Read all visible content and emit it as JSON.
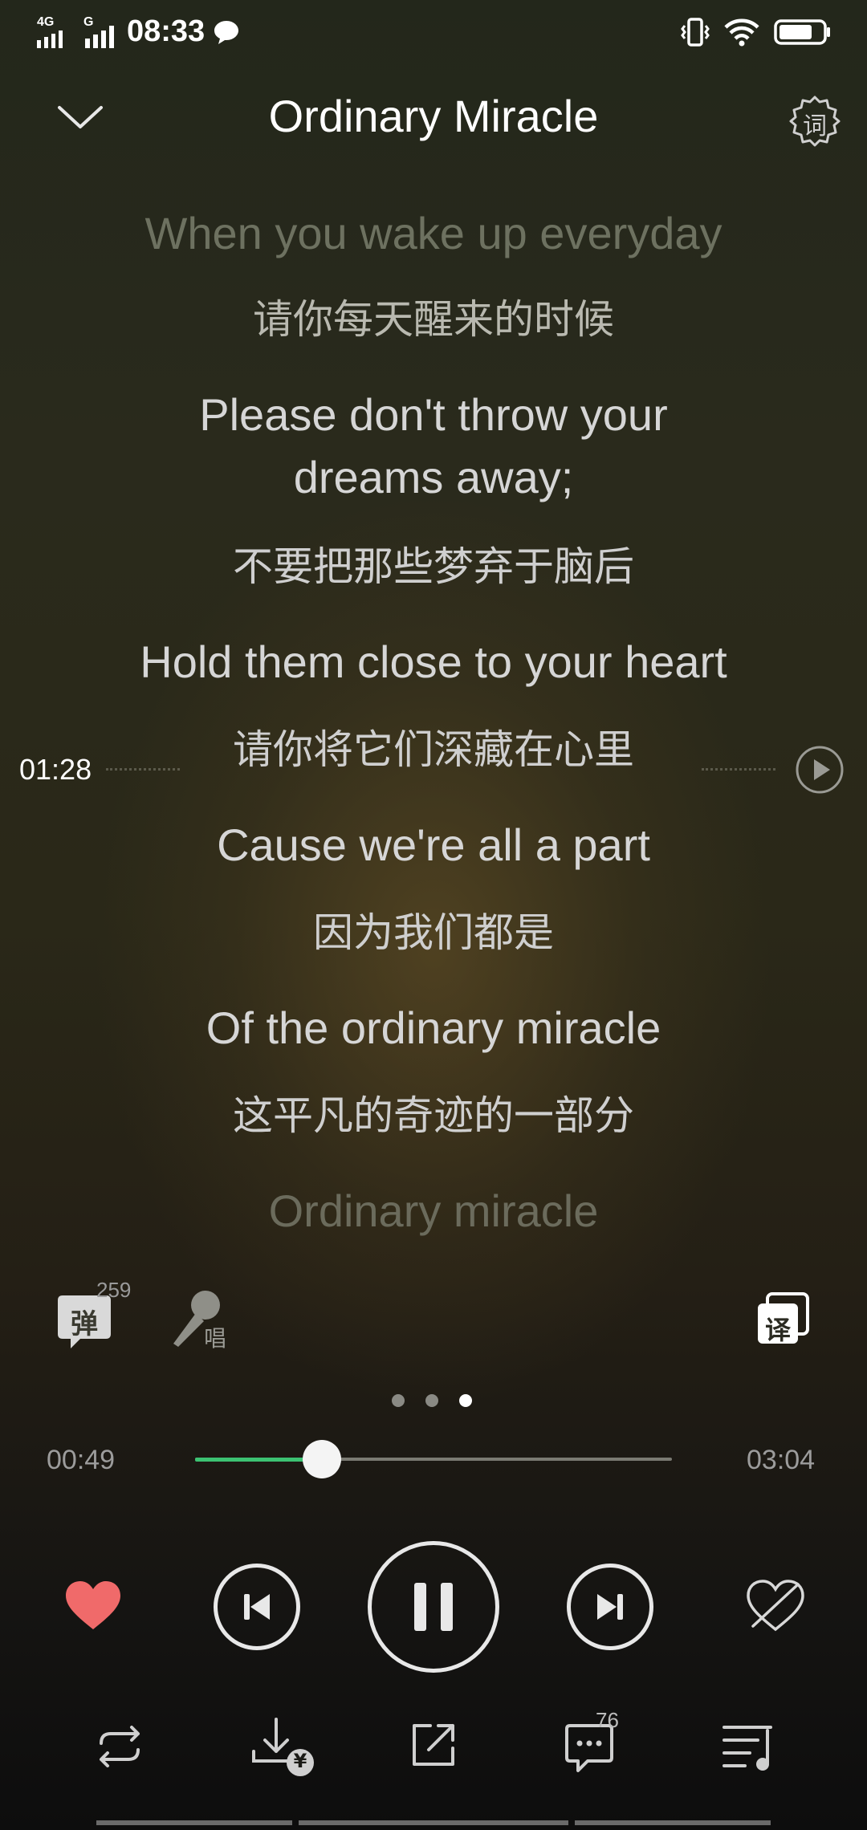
{
  "status_bar": {
    "network_1": "4G",
    "network_2": "G",
    "time": "08:33",
    "icons": [
      "signal-icon",
      "signal-icon",
      "message-bubble-icon",
      "vibrate-icon",
      "wifi-icon",
      "battery-icon"
    ]
  },
  "header": {
    "title": "Ordinary Miracle",
    "lyrics_settings_label": "词"
  },
  "lyrics": [
    {
      "en": "When you wake up everyday",
      "zh": "请你每天醒来的时候"
    },
    {
      "en": "Please don't throw your dreams away;",
      "zh": "不要把那些梦弃于脑后"
    },
    {
      "en": "Hold them close to your heart",
      "zh": "请你将它们深藏在心里"
    },
    {
      "en": "Cause we're all a part",
      "zh": "因为我们都是"
    },
    {
      "en": "Of the ordinary miracle",
      "zh": "这平凡的奇迹的一部分"
    },
    {
      "en": "Ordinary miracle",
      "zh": ""
    }
  ],
  "seek_marker": {
    "time": "01:28"
  },
  "tools": {
    "danmu_label": "弹",
    "danmu_count": "259",
    "sing_label": "唱",
    "translate_label": "译"
  },
  "pager": {
    "count": 3,
    "active_index": 2
  },
  "playback": {
    "elapsed": "00:49",
    "duration": "03:04",
    "progress": 0.266,
    "accent_color": "#3cc272",
    "like_color": "#f06a6a"
  },
  "bottom_bar": {
    "comments_count": "76",
    "download_price_label": "¥"
  }
}
